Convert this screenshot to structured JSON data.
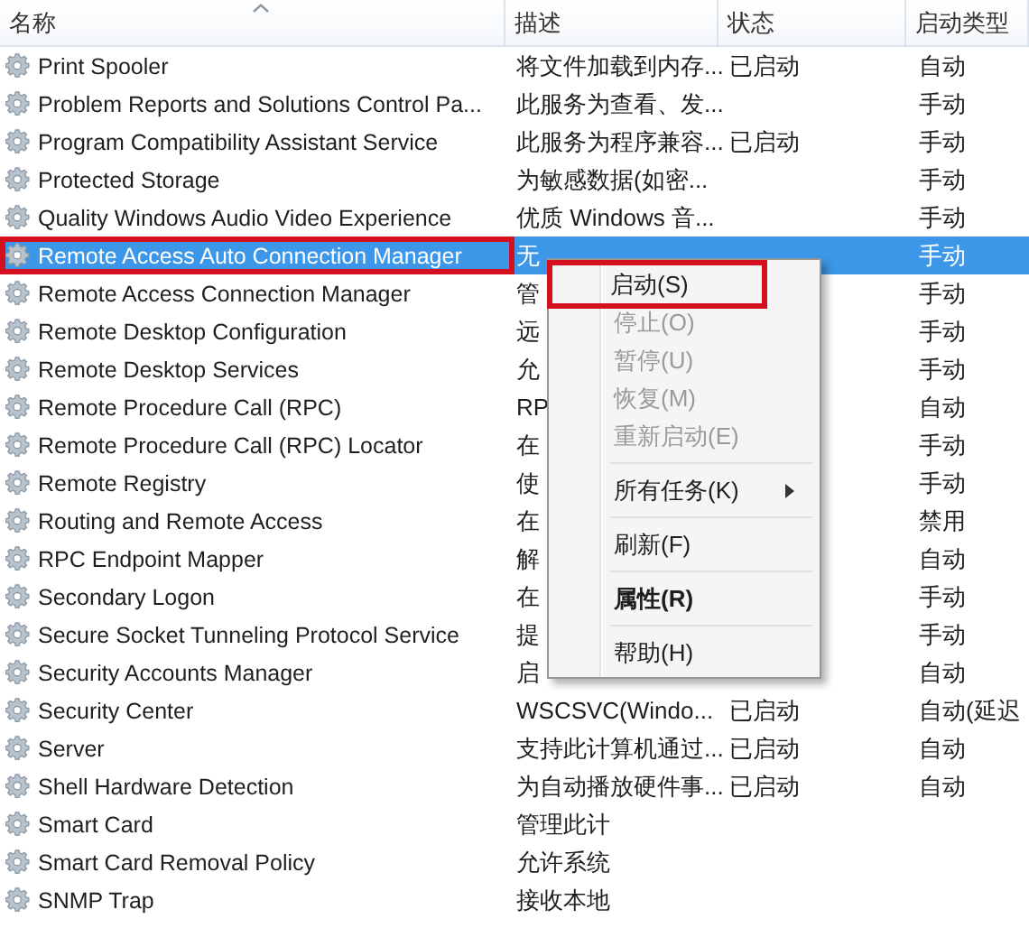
{
  "columns": [
    {
      "label": "名称",
      "sorted": true
    },
    {
      "label": "描述",
      "sorted": false
    },
    {
      "label": "状态",
      "sorted": false
    },
    {
      "label": "启动类型",
      "sorted": false
    }
  ],
  "rows": [
    {
      "name": "Print Spooler",
      "description": "将文件加载到内存...",
      "status": "已启动",
      "startup": "自动",
      "selected": false,
      "highlighted": false
    },
    {
      "name": "Problem Reports and Solutions Control Pa...",
      "description": "此服务为查看、发...",
      "startup": "手动",
      "selected": false,
      "highlighted": false
    },
    {
      "name": "Program Compatibility Assistant Service",
      "description": "此服务为程序兼容...",
      "status": "已启动",
      "startup": "手动",
      "selected": false,
      "highlighted": false
    },
    {
      "name": "Protected Storage",
      "description": "为敏感数据(如密...",
      "startup": "手动",
      "selected": false,
      "highlighted": false
    },
    {
      "name": "Quality Windows Audio Video Experience",
      "description": "优质 Windows 音...",
      "startup": "手动",
      "selected": false,
      "highlighted": false
    },
    {
      "name": "Remote Access Auto Connection Manager",
      "description": "无",
      "startup": "手动",
      "selected": true,
      "highlighted": true
    },
    {
      "name": "Remote Access Connection Manager",
      "description": "管",
      "startup": "手动",
      "selected": false,
      "highlighted": false
    },
    {
      "name": "Remote Desktop Configuration",
      "description": "远",
      "startup": "手动",
      "selected": false,
      "highlighted": false
    },
    {
      "name": "Remote Desktop Services",
      "description": "允",
      "startup": "手动",
      "selected": false,
      "highlighted": false
    },
    {
      "name": "Remote Procedure Call (RPC)",
      "description": "RP",
      "startup": "自动",
      "selected": false,
      "highlighted": false
    },
    {
      "name": "Remote Procedure Call (RPC) Locator",
      "description": "在",
      "startup": "手动",
      "selected": false,
      "highlighted": false
    },
    {
      "name": "Remote Registry",
      "description": "使",
      "startup": "手动",
      "selected": false,
      "highlighted": false
    },
    {
      "name": "Routing and Remote Access",
      "description": "在",
      "startup": "禁用",
      "selected": false,
      "highlighted": false
    },
    {
      "name": "RPC Endpoint Mapper",
      "description": "解",
      "startup": "自动",
      "selected": false,
      "highlighted": false
    },
    {
      "name": "Secondary Logon",
      "description": "在",
      "startup": "手动",
      "selected": false,
      "highlighted": false
    },
    {
      "name": "Secure Socket Tunneling Protocol Service",
      "description": "提",
      "startup": "手动",
      "selected": false,
      "highlighted": false
    },
    {
      "name": "Security Accounts Manager",
      "description": "启",
      "startup": "自动",
      "selected": false,
      "highlighted": false
    },
    {
      "name": "Security Center",
      "description": "WSCSVC(Windo...",
      "status": "已启动",
      "startup": "自动(延迟",
      "selected": false,
      "highlighted": false
    },
    {
      "name": "Server",
      "description": "支持此计算机通过...",
      "status": "已启动",
      "startup": "自动",
      "selected": false,
      "highlighted": false
    },
    {
      "name": "Shell Hardware Detection",
      "description": "为自动播放硬件事...",
      "status": "已启动",
      "startup": "自动",
      "selected": false,
      "highlighted": false
    },
    {
      "name": "Smart Card",
      "description": "管理此计",
      "selected": false,
      "highlighted": false
    },
    {
      "name": "Smart Card Removal Policy",
      "description": "允许系统",
      "selected": false,
      "highlighted": false
    },
    {
      "name": "SNMP Trap",
      "description": "接收本地",
      "selected": false,
      "highlighted": false
    }
  ],
  "context_menu": [
    {
      "kind": "item",
      "label": "启动(S)",
      "disabled": false,
      "bold": false,
      "submenu": false,
      "highlighted": true
    },
    {
      "kind": "item",
      "label": "停止(O)",
      "disabled": true,
      "bold": false,
      "submenu": false,
      "highlighted": false
    },
    {
      "kind": "item",
      "label": "暂停(U)",
      "disabled": true,
      "bold": false,
      "submenu": false,
      "highlighted": false
    },
    {
      "kind": "item",
      "label": "恢复(M)",
      "disabled": true,
      "bold": false,
      "submenu": false,
      "highlighted": false
    },
    {
      "kind": "item",
      "label": "重新启动(E)",
      "disabled": true,
      "bold": false,
      "submenu": false,
      "highlighted": false
    },
    {
      "kind": "separator"
    },
    {
      "kind": "item",
      "label": "所有任务(K)",
      "disabled": false,
      "bold": false,
      "submenu": true,
      "highlighted": false
    },
    {
      "kind": "separator"
    },
    {
      "kind": "item",
      "label": "刷新(F)",
      "disabled": false,
      "bold": false,
      "submenu": false,
      "highlighted": false
    },
    {
      "kind": "separator"
    },
    {
      "kind": "item",
      "label": "属性(R)",
      "disabled": false,
      "bold": true,
      "submenu": false,
      "highlighted": false
    },
    {
      "kind": "separator"
    },
    {
      "kind": "item",
      "label": "帮助(H)",
      "disabled": false,
      "bold": false,
      "submenu": false,
      "highlighted": false
    }
  ]
}
